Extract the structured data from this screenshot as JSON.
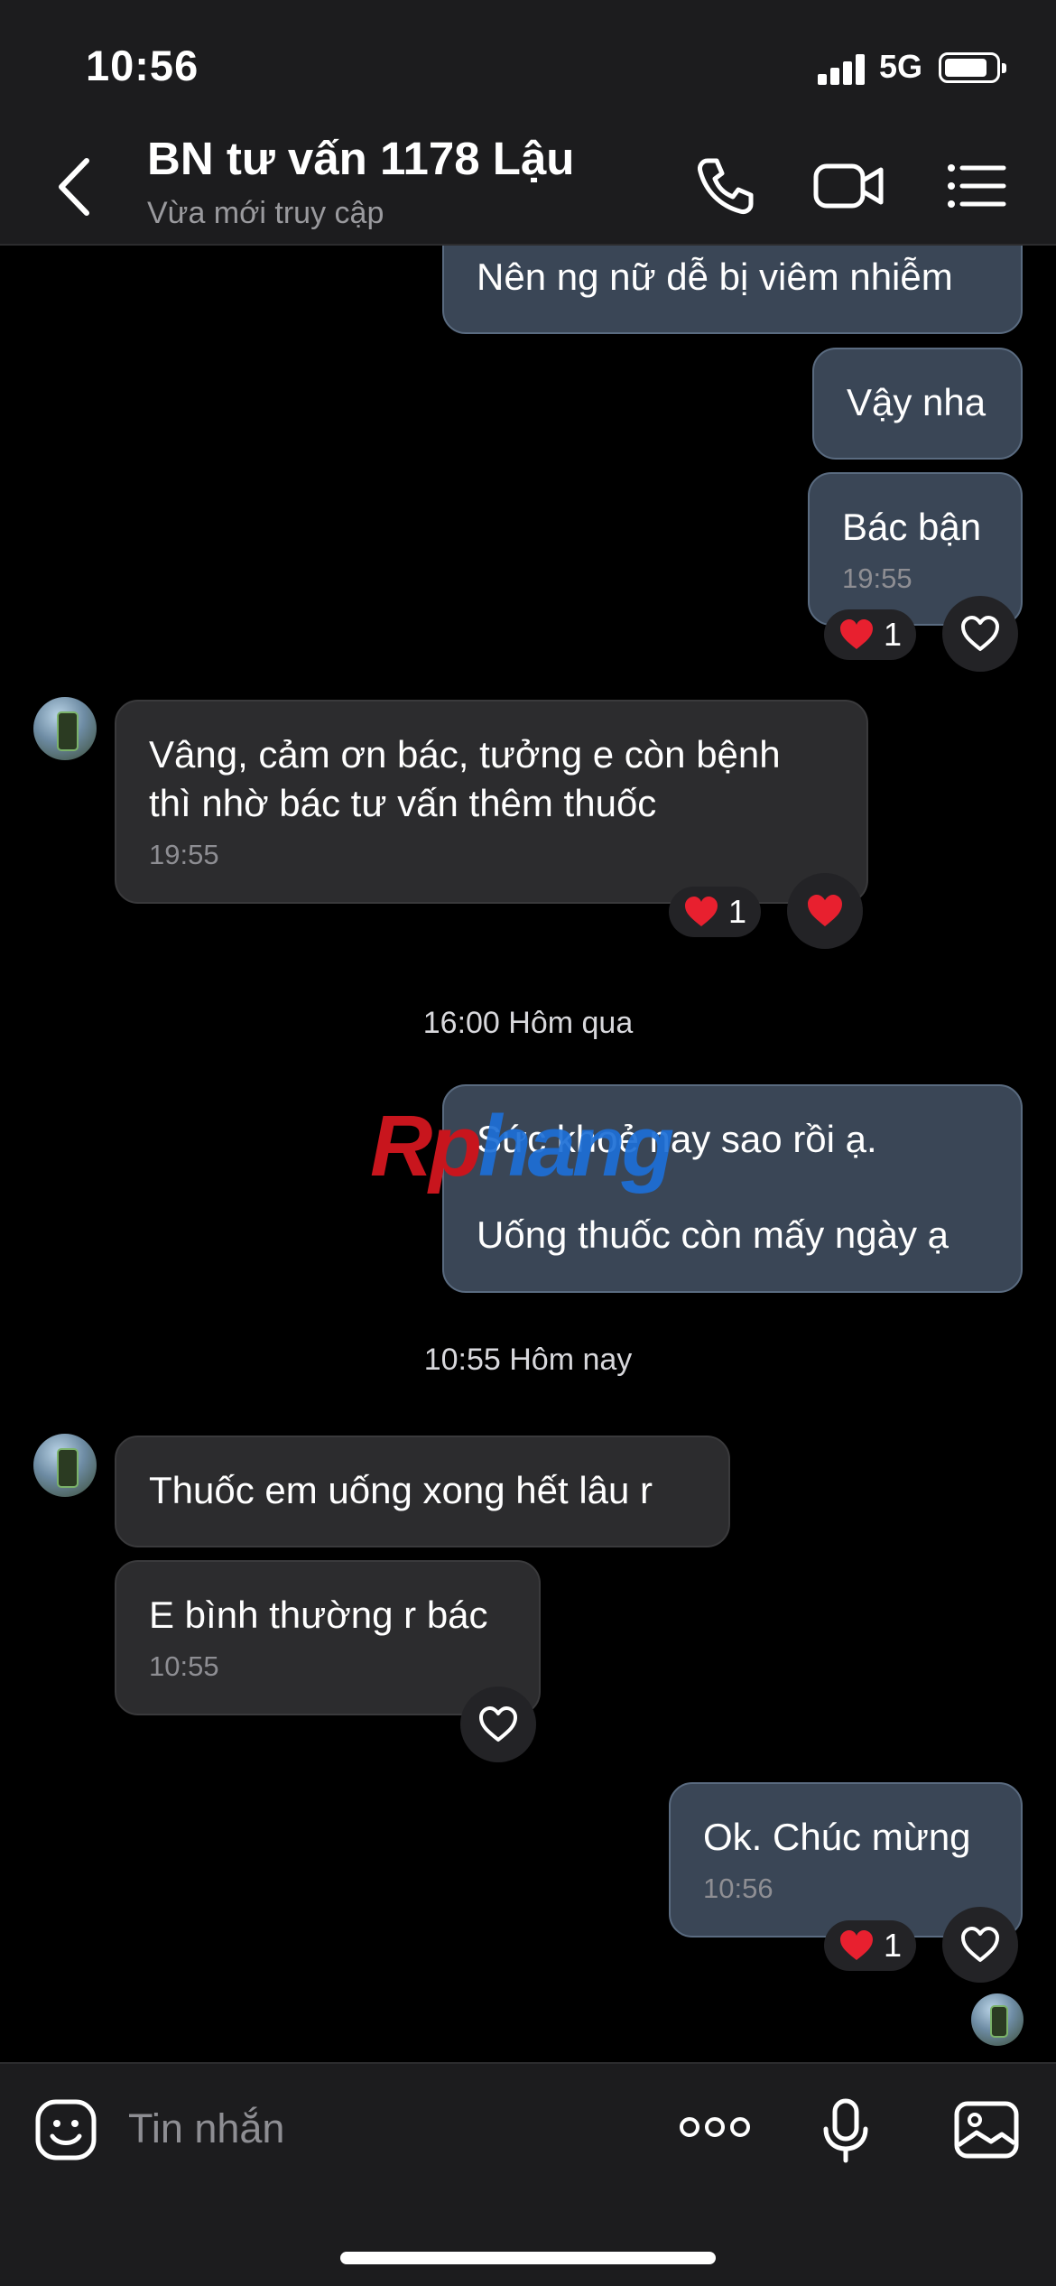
{
  "status_bar": {
    "time": "10:56",
    "network": "5G"
  },
  "header": {
    "title": "BN tư vấn 1178 Lậu",
    "subtitle": "Vừa mới truy cập",
    "back_icon": "chevron-left-icon",
    "call_icon": "phone-icon",
    "video_icon": "video-camera-icon",
    "menu_icon": "list-menu-icon"
  },
  "messages": {
    "m1": {
      "text": "Nên ng nữ dễ bị viêm nhiễm"
    },
    "m2": {
      "text": "Vậy nha"
    },
    "m3": {
      "text": "Bác bận",
      "time": "19:55",
      "reaction_count": "1"
    },
    "m4": {
      "line1": "Vâng, cảm ơn bác, tưởng e còn bệnh",
      "line2": "thì nhờ bác tư vấn thêm thuốc",
      "time": "19:55",
      "reaction_count": "1"
    },
    "m5": {
      "line1": "Sức khoẻ nay sao rồi ạ.",
      "line2": "Uống thuốc còn mấy ngày ạ"
    },
    "m6": {
      "text": "Thuốc em uống xong hết lâu r"
    },
    "m7": {
      "text": "E bình thường r bác",
      "time": "10:55"
    },
    "m8": {
      "text": "Ok. Chúc mừng",
      "time": "10:56",
      "reaction_count": "1"
    }
  },
  "dividers": {
    "d1": "16:00 Hôm qua",
    "d2": "10:55 Hôm nay"
  },
  "watermark": {
    "part1": "Rp",
    "part2": "hang"
  },
  "composer": {
    "placeholder": "Tin nhắn",
    "emoji_icon": "emoji-sticker-icon",
    "more_icon": "more-dots-icon",
    "mic_icon": "microphone-icon",
    "image_icon": "image-icon"
  },
  "colors": {
    "outgoing_bubble": "#3a4656",
    "incoming_bubble": "#2c2c2e",
    "heart": "#e8202f",
    "background": "#000000"
  }
}
